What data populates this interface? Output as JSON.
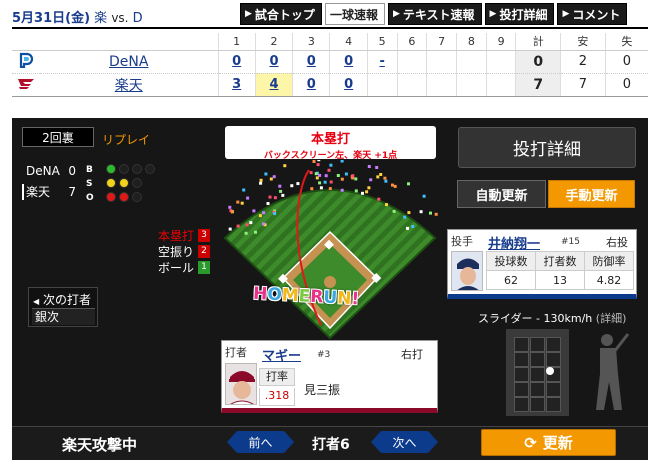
{
  "header": {
    "date": "5月31日(金)",
    "home_short": "楽",
    "vs": "vs.",
    "away_short": "D"
  },
  "nav_tabs": [
    {
      "label": "試合トップ",
      "active": false
    },
    {
      "label": "一球速報",
      "active": true
    },
    {
      "label": "テキスト速報",
      "active": false
    },
    {
      "label": "投打詳細",
      "active": false
    },
    {
      "label": "コメント",
      "active": false
    }
  ],
  "scoreboard": {
    "innings": [
      "1",
      "2",
      "3",
      "4",
      "5",
      "6",
      "7",
      "8",
      "9"
    ],
    "total_headers": [
      "計",
      "安",
      "失"
    ],
    "rows": [
      {
        "team": "DeNA",
        "innings": [
          "0",
          "0",
          "0",
          "0",
          "-",
          "",
          "",
          "",
          ""
        ],
        "r": "0",
        "h": "2",
        "e": "0"
      },
      {
        "team": "楽天",
        "innings": [
          "3",
          "4",
          "0",
          "0",
          "",
          "",
          "",
          "",
          ""
        ],
        "r": "7",
        "h": "7",
        "e": "0"
      }
    ]
  },
  "situation": {
    "inning": "2回裏",
    "mode": "リプレイ",
    "teams": [
      {
        "name": "DeNA",
        "score": "0"
      },
      {
        "name": "楽天",
        "score": "7"
      }
    ],
    "bso_labels": [
      "B",
      "S",
      "O"
    ],
    "balls": 1,
    "strikes": 2,
    "outs": 2
  },
  "plays": [
    {
      "label": "本塁打",
      "num": "3"
    },
    {
      "label": "空振り",
      "num": "2"
    },
    {
      "label": "ボール",
      "num": "1"
    }
  ],
  "next_batter": {
    "label": "次の打者",
    "name": "銀次"
  },
  "result": {
    "title": "本塁打",
    "detail": "バックスクリーン左、楽天 +1点",
    "effect": "HOMERUN!"
  },
  "controls": {
    "detail_button": "投打詳細",
    "auto_update": "自動更新",
    "manual_update": "手動更新"
  },
  "pitcher": {
    "role": "投手",
    "name": "井納翔一",
    "number": "#15",
    "hand": "右投",
    "stat_headers": [
      "投球数",
      "打者数",
      "防御率"
    ],
    "stat_values": [
      "62",
      "13",
      "4.82"
    ]
  },
  "pitch_info": {
    "text": "スライダー - 130km/h",
    "detail": "(詳細)"
  },
  "batter": {
    "role": "打者",
    "name": "マギー",
    "number": "#3",
    "hand": "右打",
    "avg_label": "打率",
    "avg": ".318",
    "result": "見三振"
  },
  "footer": {
    "attack": "楽天攻撃中",
    "prev": "前へ",
    "batter_no": "打者6",
    "next": "次へ",
    "refresh": "更新"
  },
  "colors": {
    "accent_orange": "#f39800",
    "link_blue": "#1a3c8c",
    "alert_red": "#e60012"
  }
}
